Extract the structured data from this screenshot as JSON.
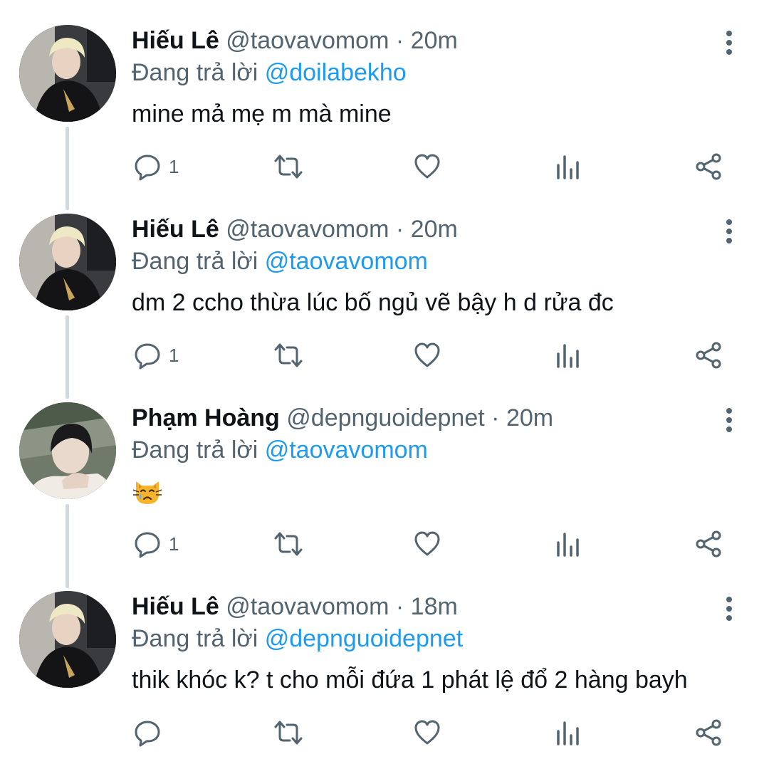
{
  "reply_prefix": "Đang trả lời",
  "colors": {
    "text": "#0f1419",
    "muted": "#536471",
    "link": "#1d9bf0",
    "thread": "#cfd9de"
  },
  "tweets": [
    {
      "name": "Hiếu Lê",
      "handle": "@taovavomom",
      "sep": "·",
      "time": "20m",
      "reply_to": "@doilabekho",
      "text": "mine mả mẹ m mà mine",
      "reply_count": "1",
      "icons": [
        "reply-icon",
        "retweet-icon",
        "like-icon",
        "analytics-icon",
        "share-icon"
      ]
    },
    {
      "name": "Hiếu Lê",
      "handle": "@taovavomom",
      "sep": "·",
      "time": "20m",
      "reply_to": "@taovavomom",
      "text": "dm 2 ccho thừa lúc bố ngủ vẽ bậy h d rửa đc",
      "reply_count": "1",
      "icons": [
        "reply-icon",
        "retweet-icon",
        "like-icon",
        "analytics-icon",
        "share-icon"
      ]
    },
    {
      "name": "Phạm Hoàng",
      "handle": "@depnguoidepnet",
      "sep": "·",
      "time": "20m",
      "reply_to": "@taovavomom",
      "text": "",
      "emoji": "crying-cat-face-emoji",
      "reply_count": "1",
      "icons": [
        "reply-icon",
        "retweet-icon",
        "like-icon",
        "analytics-icon",
        "share-icon"
      ]
    },
    {
      "name": "Hiếu Lê",
      "handle": "@taovavomom",
      "sep": "·",
      "time": "18m",
      "reply_to": "@depnguoidepnet",
      "text": "thik khóc k? t cho mỗi đứa 1 phát lệ đổ 2 hàng bayh",
      "reply_count": "",
      "icons": [
        "reply-icon",
        "retweet-icon",
        "like-icon",
        "analytics-icon",
        "share-icon"
      ]
    }
  ]
}
